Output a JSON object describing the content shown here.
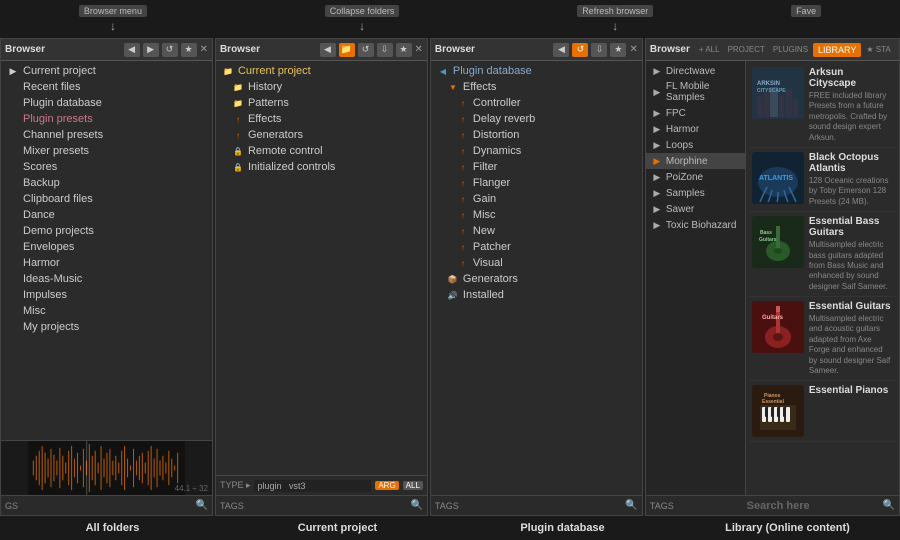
{
  "topbar": {
    "labels": [
      {
        "id": "browser-menu",
        "text": "Browser menu",
        "offset": "left"
      },
      {
        "id": "collapse-folders",
        "text": "Collapse folders",
        "offset": "center-left"
      },
      {
        "id": "refresh-browser",
        "text": "Refresh browser",
        "offset": "center"
      },
      {
        "id": "favorites",
        "text": "Fave",
        "offset": "right"
      }
    ]
  },
  "panels": [
    {
      "id": "all-folders",
      "title": "Browser",
      "items": [
        {
          "label": "Current project",
          "indent": 0,
          "icon": "▶"
        },
        {
          "label": "Recent files",
          "indent": 0,
          "icon": ""
        },
        {
          "label": "Plugin database",
          "indent": 0,
          "icon": ""
        },
        {
          "label": "Plugin presets",
          "indent": 0,
          "icon": ""
        },
        {
          "label": "Channel presets",
          "indent": 0,
          "icon": ""
        },
        {
          "label": "Mixer presets",
          "indent": 0,
          "icon": ""
        },
        {
          "label": "Scores",
          "indent": 0,
          "icon": ""
        },
        {
          "label": "Backup",
          "indent": 0,
          "icon": ""
        },
        {
          "label": "Clipboard files",
          "indent": 0,
          "icon": ""
        },
        {
          "label": "Dance",
          "indent": 0,
          "icon": ""
        },
        {
          "label": "Demo projects",
          "indent": 0,
          "icon": ""
        },
        {
          "label": "Envelopes",
          "indent": 0,
          "icon": ""
        },
        {
          "label": "Harmor",
          "indent": 0,
          "icon": ""
        },
        {
          "label": "Ideas-Music",
          "indent": 0,
          "icon": ""
        },
        {
          "label": "Impulses",
          "indent": 0,
          "icon": ""
        },
        {
          "label": "Misc",
          "indent": 0,
          "icon": ""
        },
        {
          "label": "My projects",
          "indent": 0,
          "icon": ""
        }
      ],
      "footer": {
        "tag": "GS",
        "value": "44.1 ÷ 32",
        "badge": ""
      },
      "bottomLabel": "All folders"
    },
    {
      "id": "current-project",
      "title": "Browser",
      "rootItem": "Current project",
      "items": [
        {
          "label": "History",
          "indent": 1,
          "icon": "📁",
          "iconClass": "icon-folder"
        },
        {
          "label": "Patterns",
          "indent": 1,
          "icon": "📁",
          "iconClass": "icon-folder"
        },
        {
          "label": "Effects",
          "indent": 1,
          "icon": "↑",
          "iconClass": "icon-orange"
        },
        {
          "label": "Generators",
          "indent": 1,
          "icon": "↑",
          "iconClass": "icon-orange"
        },
        {
          "label": "Remote control",
          "indent": 1,
          "icon": "🔒",
          "iconClass": "icon-gray"
        },
        {
          "label": "Initialized controls",
          "indent": 1,
          "icon": "🔒",
          "iconClass": "icon-gray"
        }
      ],
      "footer": {
        "tag": "TYPE ▸",
        "input": "plugin   vst3",
        "badge": "ARG",
        "badge2": "ALL"
      },
      "footerTag2": "TAGS",
      "bottomLabel": "Current project"
    },
    {
      "id": "plugin-database",
      "title": "Browser",
      "rootItem": "Plugin database",
      "items": [
        {
          "label": "Effects",
          "indent": 1,
          "icon": "↑",
          "iconClass": "icon-orange",
          "expanded": true
        },
        {
          "label": "Controller",
          "indent": 2,
          "icon": "↑",
          "iconClass": "icon-orange"
        },
        {
          "label": "Delay reverb",
          "indent": 2,
          "icon": "↑",
          "iconClass": "icon-orange"
        },
        {
          "label": "Distortion",
          "indent": 2,
          "icon": "↑",
          "iconClass": "icon-orange"
        },
        {
          "label": "Dynamics",
          "indent": 2,
          "icon": "↑",
          "iconClass": "icon-orange"
        },
        {
          "label": "Filter",
          "indent": 2,
          "icon": "↑",
          "iconClass": "icon-orange"
        },
        {
          "label": "Flanger",
          "indent": 2,
          "icon": "↑",
          "iconClass": "icon-orange"
        },
        {
          "label": "Gain",
          "indent": 2,
          "icon": "↑",
          "iconClass": "icon-orange"
        },
        {
          "label": "Misc",
          "indent": 2,
          "icon": "↑",
          "iconClass": "icon-orange"
        },
        {
          "label": "New",
          "indent": 2,
          "icon": "↑",
          "iconClass": "icon-orange"
        },
        {
          "label": "Patcher",
          "indent": 2,
          "icon": "↑",
          "iconClass": "icon-orange"
        },
        {
          "label": "Visual",
          "indent": 2,
          "icon": "↑",
          "iconClass": "icon-orange"
        },
        {
          "label": "Generators",
          "indent": 1,
          "icon": "📦",
          "iconClass": "icon-blue"
        },
        {
          "label": "Installed",
          "indent": 1,
          "icon": "🔊",
          "iconClass": "icon-green"
        }
      ],
      "footer": {
        "tag": "TAGS",
        "badge": ""
      },
      "bottomLabel": "Plugin database"
    }
  ],
  "library": {
    "id": "library",
    "title": "Browser",
    "tabs": [
      "+ ALL",
      "PROJECT",
      "PLUGINS",
      "LIBRARY",
      "★ STA"
    ],
    "activeTab": "LIBRARY",
    "sidebar": [
      {
        "label": "Directwave",
        "dotColor": ""
      },
      {
        "label": "FL Mobile Samples",
        "dotColor": ""
      },
      {
        "label": "FPC",
        "dotColor": ""
      },
      {
        "label": "Harmor",
        "dotColor": ""
      },
      {
        "label": "Loops",
        "dotColor": ""
      },
      {
        "label": "Morphine",
        "dotColor": "orange"
      },
      {
        "label": "PoiZone",
        "dotColor": ""
      },
      {
        "label": "Samples",
        "dotColor": ""
      },
      {
        "label": "Sawer",
        "dotColor": ""
      },
      {
        "label": "Toxic Biohazard",
        "dotColor": ""
      }
    ],
    "cards": [
      {
        "title": "Arksun Cityscape",
        "desc": "FREE included library Presets from a future metropolis. Crafted by sound design expert Arksun.",
        "bgColor": "#334455",
        "bgLabel": "ARKSIN\nCITYSCAPE"
      },
      {
        "title": "Black Octopus Atlantis",
        "desc": "128 Oceanic creations by Toby Emerson 128 Presets (24 MB).",
        "bgColor": "#223344",
        "bgLabel": "ATLANTIS"
      },
      {
        "title": "Essential Bass Guitars",
        "desc": "Multisampled electric bass guitars adapted from Bass Music and enhanced by sound designer Saif Sameer.",
        "bgColor": "#2a4a2a",
        "bgLabel": "Bass\nGuitars"
      },
      {
        "title": "Essential Guitars",
        "desc": "Multisampled electric and acoustic guitars adapted from Axe Forge and enhanced by sound designer Saif Sameer.",
        "bgColor": "#5a1a1a",
        "bgLabel": "Guitars"
      },
      {
        "title": "Essential Pianos",
        "desc": "",
        "bgColor": "#443322",
        "bgLabel": "Pianos"
      }
    ],
    "footer": {
      "tag": "TAGS",
      "searchLabel": "Search here"
    },
    "bottomLabel": "Library (Online content)"
  },
  "bottomLabels": [
    "All folders",
    "Current project",
    "Plugin database",
    "Library (Online content)"
  ]
}
